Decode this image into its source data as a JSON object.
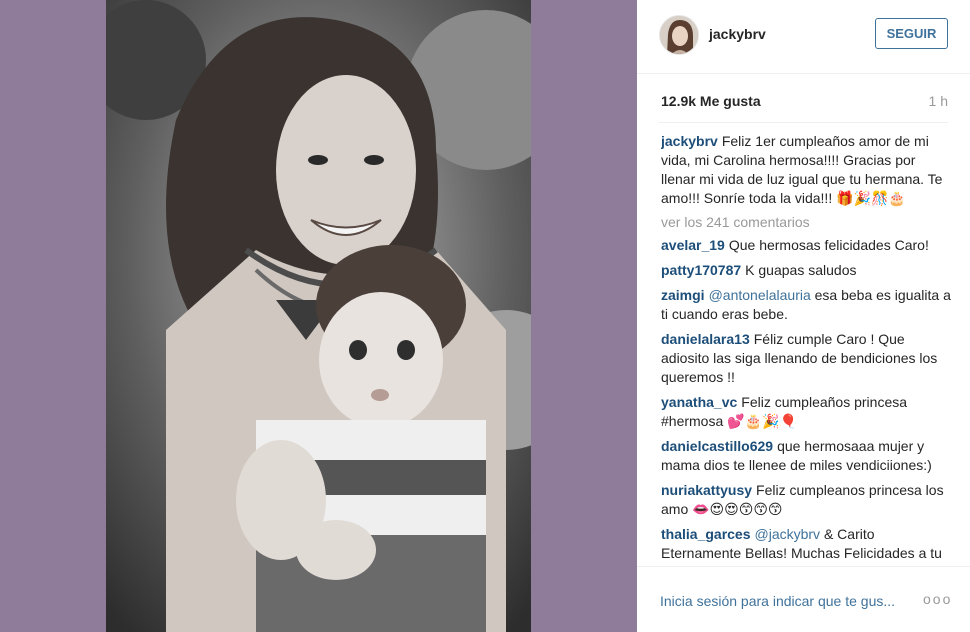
{
  "post": {
    "photo_alt": "black and white photo of a smiling woman holding a baby",
    "background_color": "#8e7c9a"
  },
  "header": {
    "username": "jackybrv",
    "follow_label": "SEGUIR",
    "avatar_icon": "avatar"
  },
  "stats": {
    "likes": "12.9k Me gusta",
    "time": "1 h"
  },
  "caption": {
    "user": "jackybrv",
    "text": "Feliz 1er cumpleaños amor de mi vida, mi Carolina hermosa!!!! Gracias por llenar mi vida de luz igual que tu hermana. Te amo!!! Sonríe toda la vida!!! 🎁🎉🎊🎂"
  },
  "view_comments": "ver los 241 comentarios",
  "comments": [
    {
      "user": "avelar_19",
      "text": "Que hermosas felicidades Caro!"
    },
    {
      "user": "patty170787",
      "text": "K guapas saludos"
    },
    {
      "user": "zaimgi",
      "mention": "@antonelalauria",
      "text": " esa beba es igualita a ti cuando eras bebe."
    },
    {
      "user": "danielalara13",
      "text": "Féliz cumple Caro ! Que adiosito las siga llenando de bendiciones los queremos !!"
    },
    {
      "user": "yanatha_vc",
      "text": "Feliz cumpleaños princesa #hermosa 💕🎂🎉🎈"
    },
    {
      "user": "danielcastillo629",
      "text": "que hermosaaa mujer y mama dios te llenee de miles vendiciiones:)"
    },
    {
      "user": "nuriakattyusy",
      "text": "Feliz cumpleanos princesa los amo 👄😍😍😙😙😙"
    },
    {
      "user": "thalia_garces",
      "mention": "@jackybrv",
      "text": " & Carito Eternamente Bellas! Muchas Felicidades a tu nena. Saludos y besos a toda tu familia"
    }
  ],
  "footer": {
    "login_text": "Inicia sesión para indicar que te gus...",
    "more_label": "ooo"
  }
}
